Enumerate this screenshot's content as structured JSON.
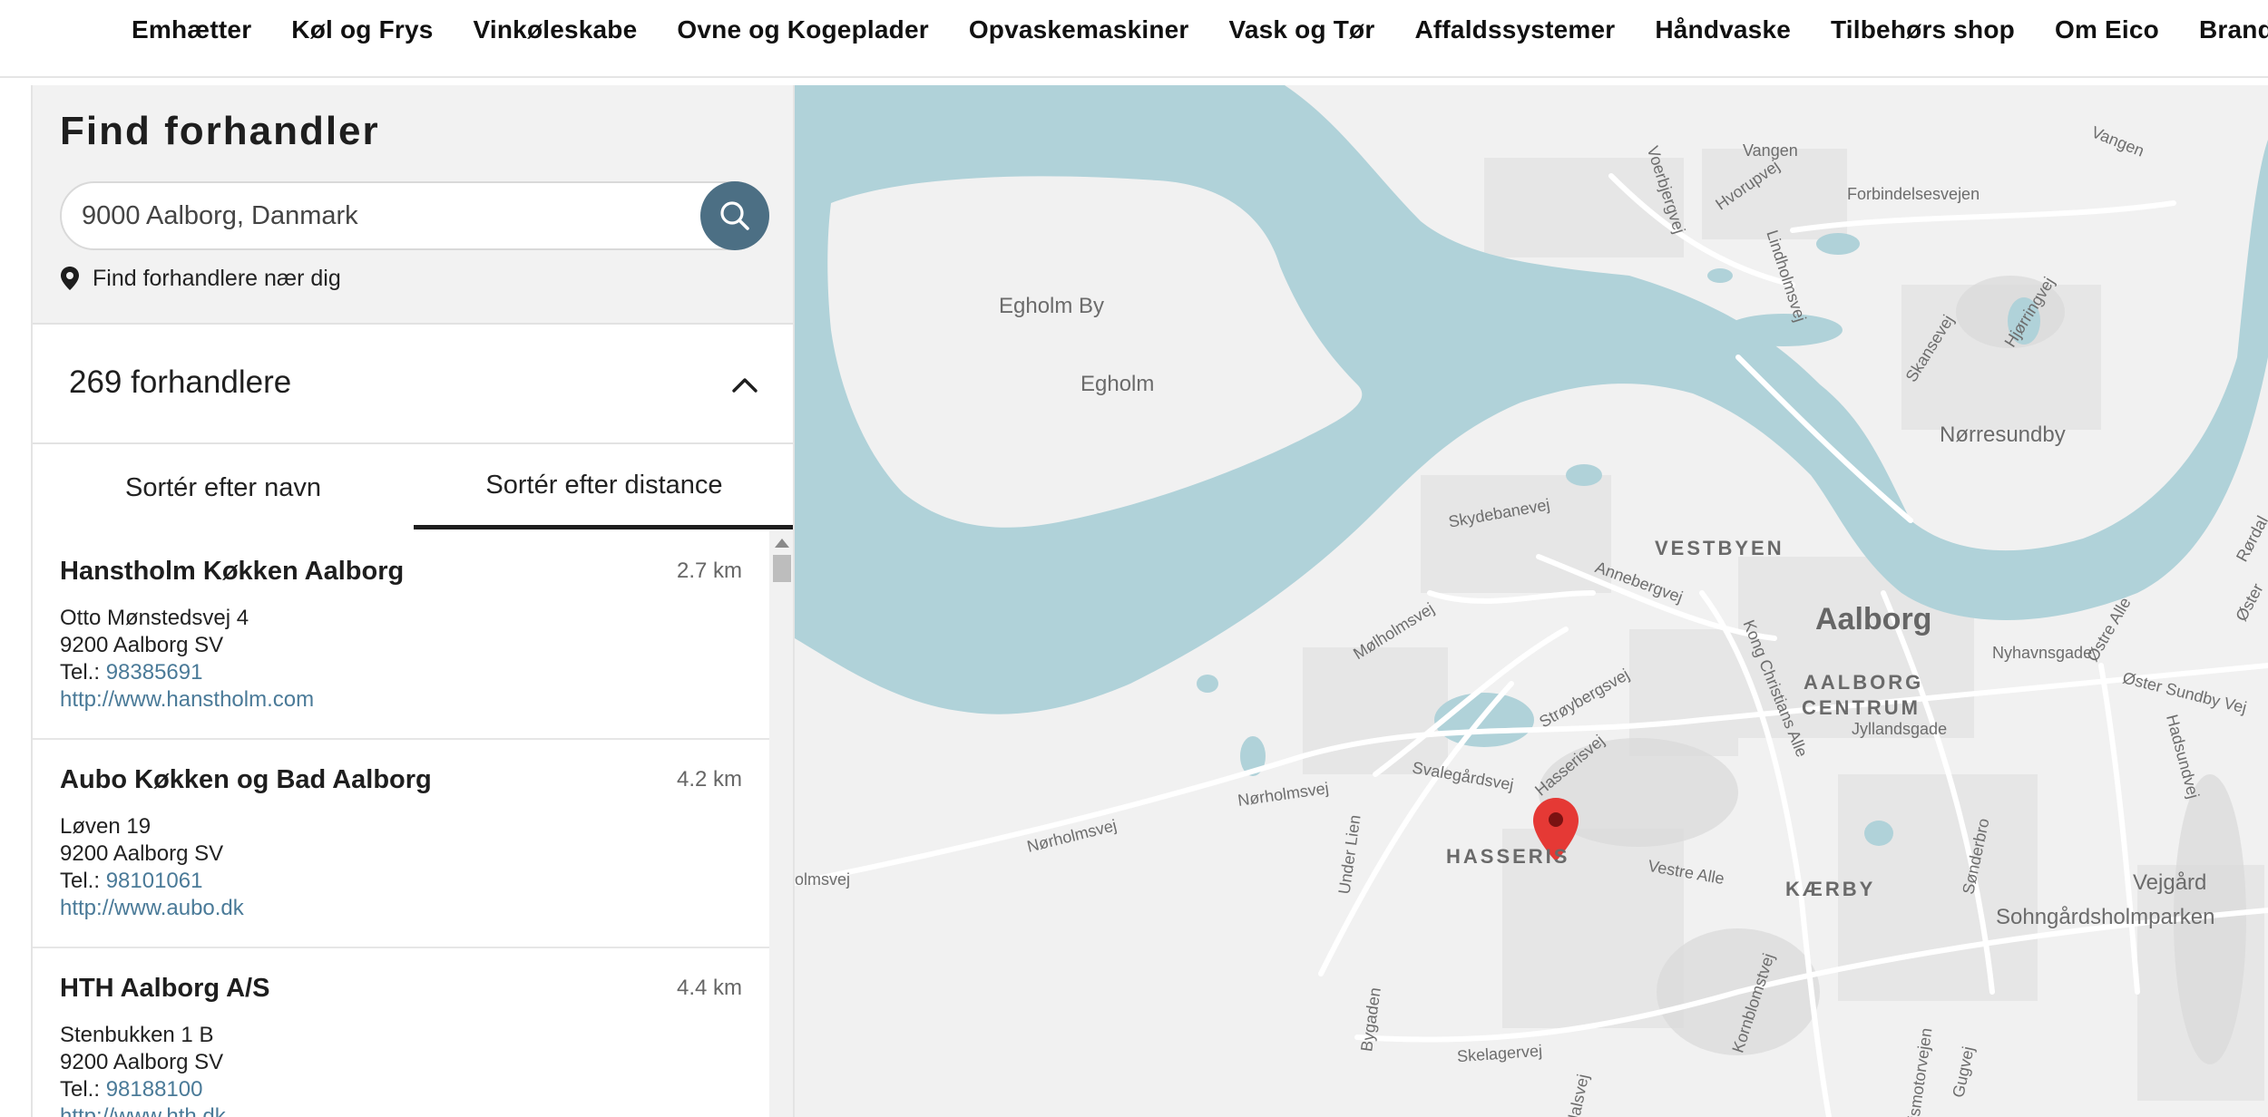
{
  "nav": {
    "items": [
      "Emhætter",
      "Køl og Frys",
      "Vinkøleskabe",
      "Ovne og Kogeplader",
      "Opvaskemaskiner",
      "Vask og Tør",
      "Affaldssystemer",
      "Håndvaske",
      "Tilbehørs shop",
      "Om Eico",
      "Brands"
    ]
  },
  "finder": {
    "title": "Find forhandler",
    "search_value": "9000 Aalborg, Danmark",
    "search_icon": "search-icon",
    "near_label": "Find forhandlere nær dig",
    "near_icon": "location-pin-icon"
  },
  "results": {
    "count_label": "269 forhandlere",
    "toggle_icon": "chevron-up-icon"
  },
  "sort": {
    "by_name": "Sortér efter navn",
    "by_distance": "Sortér efter distance",
    "active": "by_distance"
  },
  "dealers": [
    {
      "name": "Hanstholm Køkken Aalborg",
      "distance": "2.7 km",
      "street": "Otto Mønstedsvej 4",
      "city": "9200 Aalborg SV",
      "tel_label": "Tel.:",
      "tel": "98385691",
      "url": "http://www.hanstholm.com"
    },
    {
      "name": "Aubo Køkken og Bad Aalborg",
      "distance": "4.2 km",
      "street": "Løven 19",
      "city": "9200 Aalborg SV",
      "tel_label": "Tel.:",
      "tel": "98101061",
      "url": "http://www.aubo.dk"
    },
    {
      "name": "HTH Aalborg A/S",
      "distance": "4.4 km",
      "street": "Stenbukken 1 B",
      "city": "9200 Aalborg SV",
      "tel_label": "Tel.:",
      "tel": "98188100",
      "url": "http://www.hth.dk"
    }
  ],
  "map": {
    "water_color": "#b0d2d9",
    "land_color": "#f1f1f1",
    "marker_color": "#e53935",
    "marker_icon": "map-marker-icon",
    "labels": {
      "egholm_by": "Egholm By",
      "egholm": "Egholm",
      "norresundby": "Nørresundby",
      "vestbyen": "VESTBYEN",
      "aalborg": "Aalborg",
      "aalborg_centrum_1": "AALBORG",
      "aalborg_centrum_2": "CENTRUM",
      "hasseris": "HASSERIS",
      "kaerby": "KÆRBY",
      "vejgaard": "Vejgård",
      "sohngaard": "Sohngårdsholmparken",
      "vangen_1": "Vangen",
      "vangen_2": "Vangen",
      "forbindelsesvejen": "Forbindelsesvejen",
      "voerbjergvej": "Voerbjergvej",
      "hvorupvej": "Hvorupvej",
      "lindholmsvej": "Lindholmsvej",
      "skansevej": "Skansevej",
      "hjorringvej": "Hjørringvej",
      "skydebanevej": "Skydebanevej",
      "annebergvej": "Annebergvej",
      "molholmsvej": "Mølholmsvej",
      "kong_christians": "Kong Christians Alle",
      "nyhavnsgade": "Nyhavnsgade",
      "ostre_alle": "Østre Alle",
      "oster_sundby": "Øster Sundby Vej",
      "jyllandsgade": "Jyllandsgade",
      "hadsundvej": "Hadsundvej",
      "strojbergsvej": "Strøybergsvej",
      "hasserisvej": "Hasserisvej",
      "svalegaardsvej": "Svalegårdsvej",
      "norholmsvej_1": "Nørholmsvej",
      "norholmsvej_2": "Nørholmsvej",
      "olmsvej": "olmsvej",
      "under_lien": "Under Lien",
      "vestre_alle": "Vestre Alle",
      "sonderbro": "Sønderbro",
      "bygaden": "Bygaden",
      "kornblomstvej": "Kornblomstvej",
      "skelagervej": "Skelagervej",
      "dalsvej": "dalsvej",
      "ismotorvejen": "ismotorvejen",
      "gugvej": "Gugvej",
      "rordal": "Rørdal",
      "oster": "Øster"
    }
  }
}
